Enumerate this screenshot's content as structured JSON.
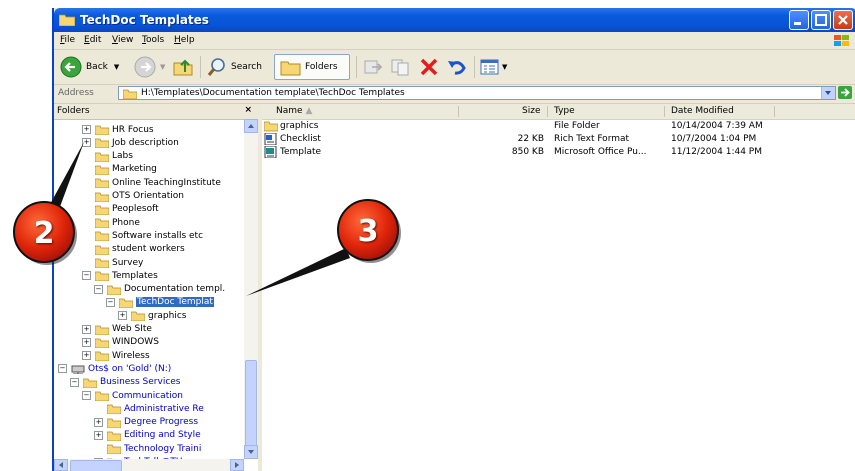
{
  "window": {
    "title": "TechDoc Templates"
  },
  "menu": [
    "File",
    "Edit",
    "View",
    "Tools",
    "Help"
  ],
  "toolbar": {
    "back": "Back",
    "search": "Search",
    "folders": "Folders"
  },
  "address": {
    "label": "Address",
    "value": "H:\\Templates\\Documentation template\\TechDoc Templates",
    "go": "Go"
  },
  "folders_pane": {
    "title": "Folders",
    "close": "×",
    "items": [
      {
        "label": "HR Focus",
        "expander": "+"
      },
      {
        "label": "Job description",
        "expander": "+"
      },
      {
        "label": "Labs",
        "expander": ""
      },
      {
        "label": "Marketing",
        "expander": ""
      },
      {
        "label": "Online TeachingInstitute",
        "expander": ""
      },
      {
        "label": "OTS Orientation",
        "expander": ""
      },
      {
        "label": "Peoplesoft",
        "expander": ""
      },
      {
        "label": "Phone",
        "expander": ""
      },
      {
        "label": "Software installs etc",
        "expander": ""
      },
      {
        "label": "student workers",
        "expander": ""
      },
      {
        "label": "Survey",
        "expander": ""
      },
      {
        "label": "Templates",
        "expander": "−"
      },
      {
        "label": "Documentation templ.",
        "expander": "−"
      },
      {
        "label": "TechDoc Templat",
        "expander": "−"
      },
      {
        "label": "graphics",
        "expander": "+"
      },
      {
        "label": "Web SIte",
        "expander": "+"
      },
      {
        "label": "WINDOWS",
        "expander": "+"
      },
      {
        "label": "Wireless",
        "expander": "+"
      },
      {
        "label": "Ots$ on 'Gold' (N:)",
        "expander": "−"
      },
      {
        "label": "Business Services",
        "expander": "−"
      },
      {
        "label": "Communication",
        "expander": "−"
      },
      {
        "label": "Administrative Re",
        "expander": ""
      },
      {
        "label": "Degree Progress",
        "expander": "+"
      },
      {
        "label": "Editing and Style",
        "expander": "+"
      },
      {
        "label": "Technology Traini",
        "expander": ""
      },
      {
        "label": "TechTalk@TU",
        "expander": "+"
      }
    ]
  },
  "columns": {
    "name": "Name",
    "size": "Size",
    "type": "Type",
    "modified": "Date Modified"
  },
  "files": [
    {
      "name": "graphics",
      "size": "",
      "type": "File Folder",
      "modified": "10/14/2004 7:39 AM",
      "icon": "folder-icon"
    },
    {
      "name": "Checklist",
      "size": "22 KB",
      "type": "Rich Text Format",
      "modified": "10/7/2004 1:04 PM",
      "icon": "rtf-document-icon"
    },
    {
      "name": "Template",
      "size": "850 KB",
      "type": "Microsoft Office Pu...",
      "modified": "11/12/2004 1:44 PM",
      "icon": "publisher-document-icon"
    }
  ],
  "callouts": [
    "2",
    "3"
  ]
}
